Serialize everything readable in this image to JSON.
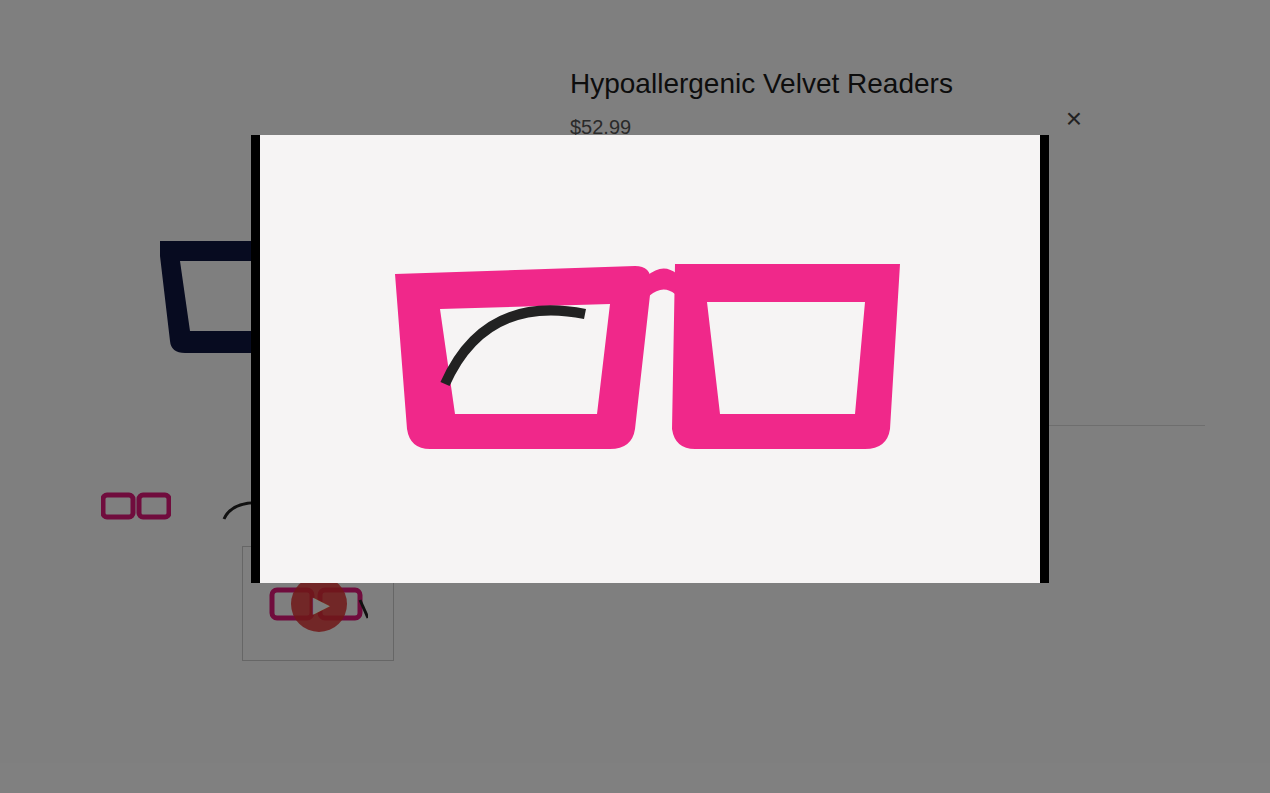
{
  "product": {
    "title": "Hypoallergenic Velvet Readers",
    "price": "$52.99"
  },
  "video_thumbnail": {
    "play": "▶"
  },
  "modal": {
    "close": "×"
  }
}
